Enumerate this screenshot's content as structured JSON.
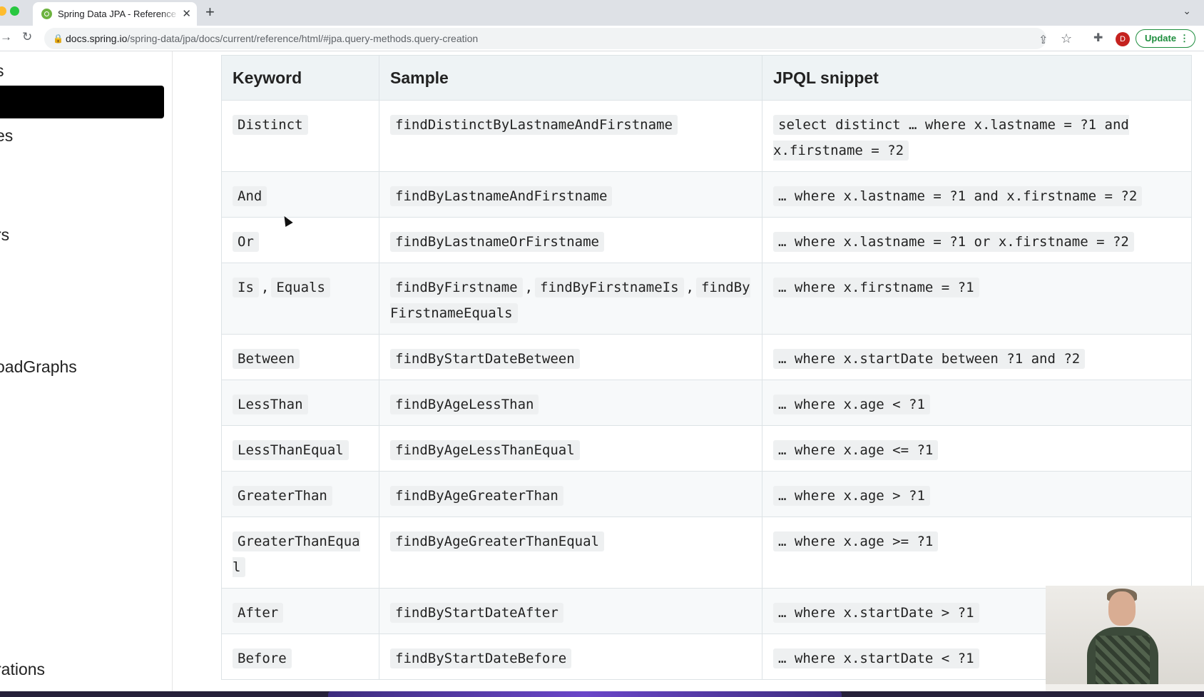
{
  "browser": {
    "tab_title": "Spring Data JPA - Reference D",
    "tab_close": "✕",
    "new_tab": "+",
    "tab_menu": "⌄",
    "url_host": "docs.spring.io",
    "url_path": "/spring-data/jpa/docs/current/reference/html/#jpa.query-methods.query-creation",
    "avatar_letter": "D",
    "update_label": "Update",
    "icons": [
      "back-icon",
      "forward-icon",
      "reload-icon",
      "lock-icon",
      "share-icon",
      "star-icon",
      "extensions-icon",
      "avatar",
      "menu-icon"
    ]
  },
  "sidebar": {
    "items": [
      "s",
      "es",
      "rs",
      "oadGraphs",
      "rations"
    ]
  },
  "table": {
    "headers": [
      "Keyword",
      "Sample",
      "JPQL snippet"
    ],
    "rows": [
      {
        "keyword": [
          "Distinct"
        ],
        "sample": [
          "findDistinctByLastnameAndFirstname"
        ],
        "jpql": [
          "select distinct … where x.lastname = ?1 and x.firstname = ?2"
        ]
      },
      {
        "keyword": [
          "And"
        ],
        "sample": [
          "findByLastnameAndFirstname"
        ],
        "jpql": [
          "… where x.lastname = ?1 and x.firstname = ?2"
        ]
      },
      {
        "keyword": [
          "Or"
        ],
        "sample": [
          "findByLastnameOrFirstname"
        ],
        "jpql": [
          "… where x.lastname = ?1 or x.firstname = ?2"
        ]
      },
      {
        "keyword": [
          "Is",
          "Equals"
        ],
        "sample": [
          "findByFirstname",
          "findByFirstnameIs",
          "findByFirstnameEquals"
        ],
        "jpql": [
          "… where x.firstname = ?1"
        ]
      },
      {
        "keyword": [
          "Between"
        ],
        "sample": [
          "findByStartDateBetween"
        ],
        "jpql": [
          "… where x.startDate between ?1 and ?2"
        ]
      },
      {
        "keyword": [
          "LessThan"
        ],
        "sample": [
          "findByAgeLessThan"
        ],
        "jpql": [
          "… where x.age < ?1"
        ]
      },
      {
        "keyword": [
          "LessThanEqual"
        ],
        "sample": [
          "findByAgeLessThanEqual"
        ],
        "jpql": [
          "… where x.age <= ?1"
        ]
      },
      {
        "keyword": [
          "GreaterThan"
        ],
        "sample": [
          "findByAgeGreaterThan"
        ],
        "jpql": [
          "… where x.age > ?1"
        ]
      },
      {
        "keyword": [
          "GreaterThanEqual"
        ],
        "sample": [
          "findByAgeGreaterThanEqual"
        ],
        "jpql": [
          "… where x.age >= ?1"
        ]
      },
      {
        "keyword": [
          "After"
        ],
        "sample": [
          "findByStartDateAfter"
        ],
        "jpql": [
          "… where x.startDate > ?1"
        ]
      },
      {
        "keyword": [
          "Before"
        ],
        "sample": [
          "findByStartDateBefore"
        ],
        "jpql": [
          "… where x.startDate < ?1"
        ]
      }
    ]
  },
  "colors": {
    "update_green": "#1e8e3e",
    "avatar_red": "#c5221f",
    "spring_green": "#6db33f"
  }
}
